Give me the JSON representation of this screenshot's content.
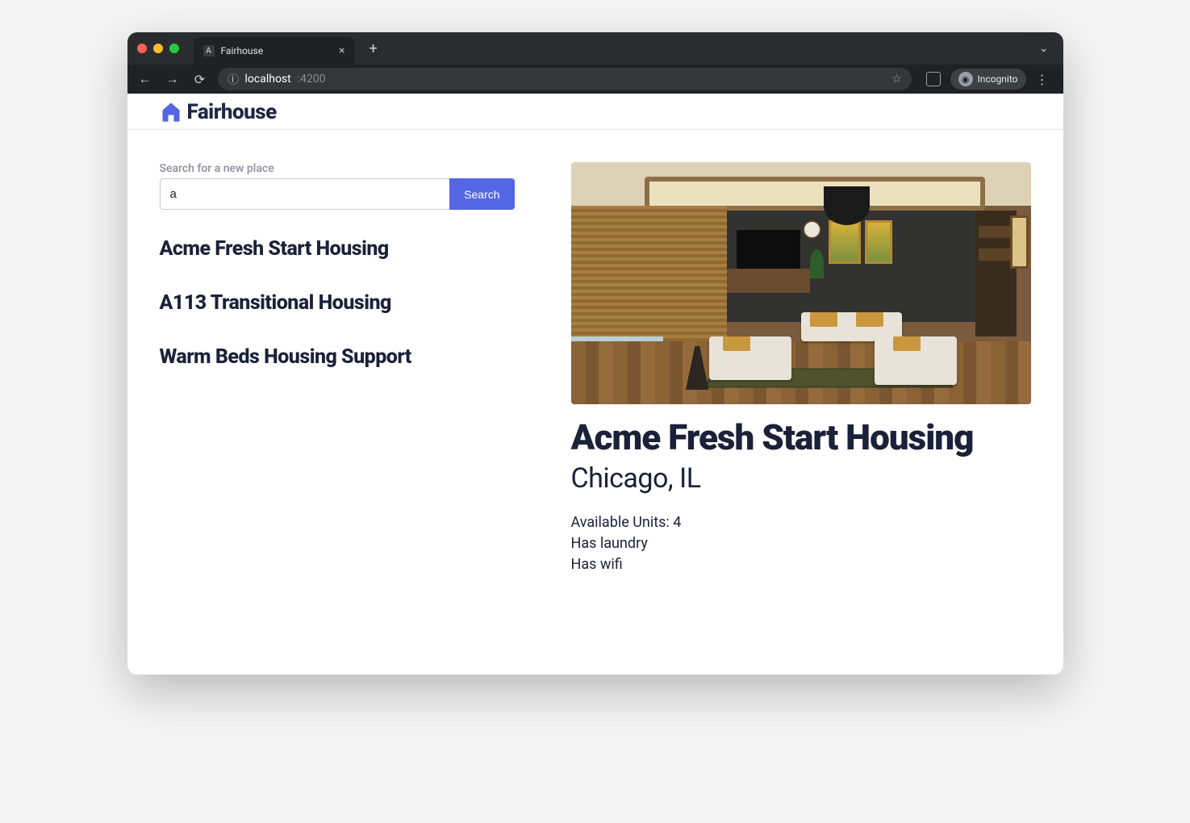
{
  "browser": {
    "tab": {
      "favicon_letter": "A",
      "title": "Fairhouse"
    },
    "url_host": "localhost",
    "url_port": ":4200",
    "incognito_label": "Incognito"
  },
  "header": {
    "brand": "Fairhouse"
  },
  "search": {
    "label": "Search for a new place",
    "value": "a",
    "button": "Search"
  },
  "results": [
    {
      "name": "Acme Fresh Start Housing"
    },
    {
      "name": "A113 Transitional Housing"
    },
    {
      "name": "Warm Beds Housing Support"
    }
  ],
  "detail": {
    "name": "Acme Fresh Start Housing",
    "location": "Chicago, IL",
    "units_label": "Available Units: 4",
    "laundry_label": "Has laundry",
    "wifi_label": "Has wifi"
  }
}
